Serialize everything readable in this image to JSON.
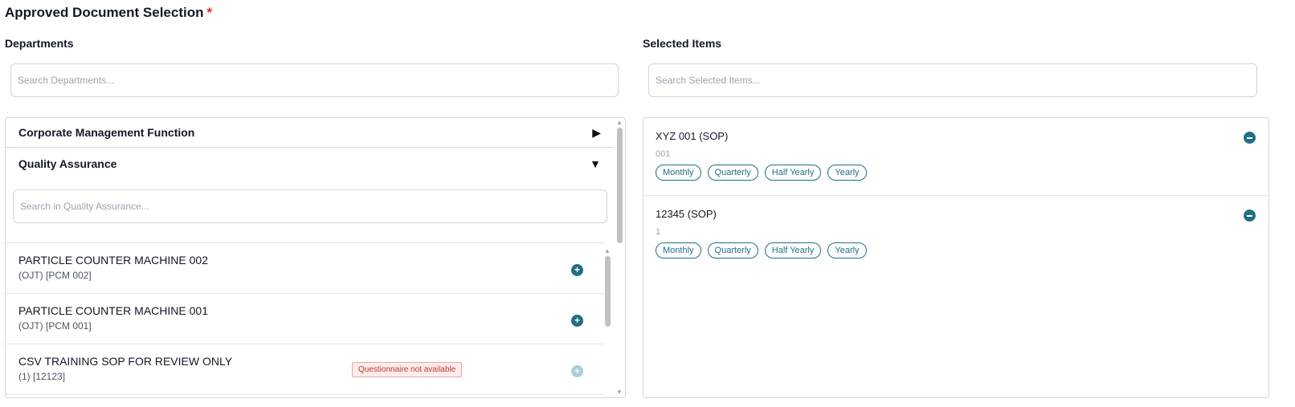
{
  "page": {
    "title": "Approved Document Selection",
    "required_mark": "*"
  },
  "departments": {
    "label": "Departments",
    "search_placeholder": "Search Departments...",
    "groups": [
      {
        "name": "Corporate Management Function",
        "expanded": false,
        "toggle": "▶"
      },
      {
        "name": "Quality Assurance",
        "expanded": true,
        "toggle": "▼",
        "search_placeholder": "Search in Quality Assurance..."
      }
    ],
    "items": [
      {
        "title": "PARTICLE COUNTER MACHINE 002",
        "sub": "(OJT) [PCM 002]",
        "add": "+",
        "disabled": false
      },
      {
        "title": "PARTICLE COUNTER MACHINE 001",
        "sub": "(OJT) [PCM 001]",
        "add": "+",
        "disabled": false
      },
      {
        "title": "CSV TRAINING SOP FOR REVIEW ONLY",
        "sub": "(1) [12123]",
        "add": "+",
        "disabled": true,
        "badge": "Questionnaire not available"
      }
    ]
  },
  "selected": {
    "label": "Selected Items",
    "search_placeholder": "Search Selected Items...",
    "items": [
      {
        "title": "XYZ 001 (SOP)",
        "code": "001",
        "tags": [
          "Monthly",
          "Quarterly",
          "Half Yearly",
          "Yearly"
        ]
      },
      {
        "title": "12345 (SOP)",
        "code": "1",
        "tags": [
          "Monthly",
          "Quarterly",
          "Half Yearly",
          "Yearly"
        ]
      }
    ]
  },
  "colors": {
    "accent": "#1f6f86",
    "required": "#dc2626",
    "badge_text": "#c0392b"
  },
  "icons": {
    "add": "plus-circle-icon",
    "remove": "minus-circle-icon",
    "collapsed": "triangle-right-icon",
    "expanded": "triangle-down-icon"
  }
}
